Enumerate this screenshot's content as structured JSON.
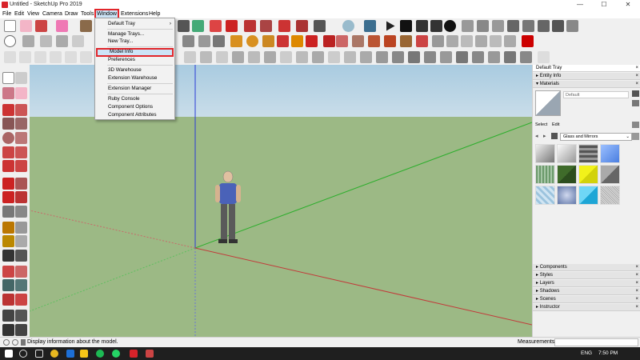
{
  "window": {
    "title": "Untitled - SketchUp Pro 2019",
    "minimize": "—",
    "maximize": "☐",
    "close": "✕"
  },
  "menubar": [
    "File",
    "Edit",
    "View",
    "Camera",
    "Draw",
    "Tools",
    "Window",
    "Extensions",
    "Help"
  ],
  "window_menu": {
    "items": [
      {
        "label": "Default Tray",
        "arrow": "›"
      },
      {
        "label": "Manage Trays..."
      },
      {
        "label": "New Tray..."
      },
      {
        "label": "Model Info",
        "highlighted": true
      },
      {
        "label": "Preferences"
      },
      {
        "label": "3D Warehouse"
      },
      {
        "label": "Extension Warehouse"
      },
      {
        "label": "Extension Manager"
      },
      {
        "label": "Ruby Console"
      },
      {
        "label": "Component Options"
      },
      {
        "label": "Component Attributes"
      }
    ]
  },
  "tray": {
    "title": "Default Tray",
    "entity_info": "Entity Info",
    "materials": "Materials",
    "material_name": "Default",
    "tab_select": "Select",
    "tab_edit": "Edit",
    "library": "Glass and Mirrors",
    "sections": [
      "Components",
      "Styles",
      "Layers",
      "Shadows",
      "Scenes",
      "Instructor"
    ],
    "close": "×"
  },
  "swatches": [
    "#9a9a9a",
    "#c9c9c9",
    "#7a7a7a",
    "#6f9be0",
    "#5b8a55",
    "#3f6b2a",
    "#e6e61a",
    "#8a8a8a",
    "#b7d6ea",
    "#8fa3c9",
    "#3fb6e6",
    "#d0d0d0"
  ],
  "statusbar": {
    "hint": "Display information about the model.",
    "measurements_label": "Measurements"
  },
  "taskbar": {
    "lang": "ENG",
    "time": "7:50 PM"
  },
  "colors": {
    "accent_red": "#e2262b",
    "ground": "#9cb985",
    "sky": "#b9d4e4"
  }
}
